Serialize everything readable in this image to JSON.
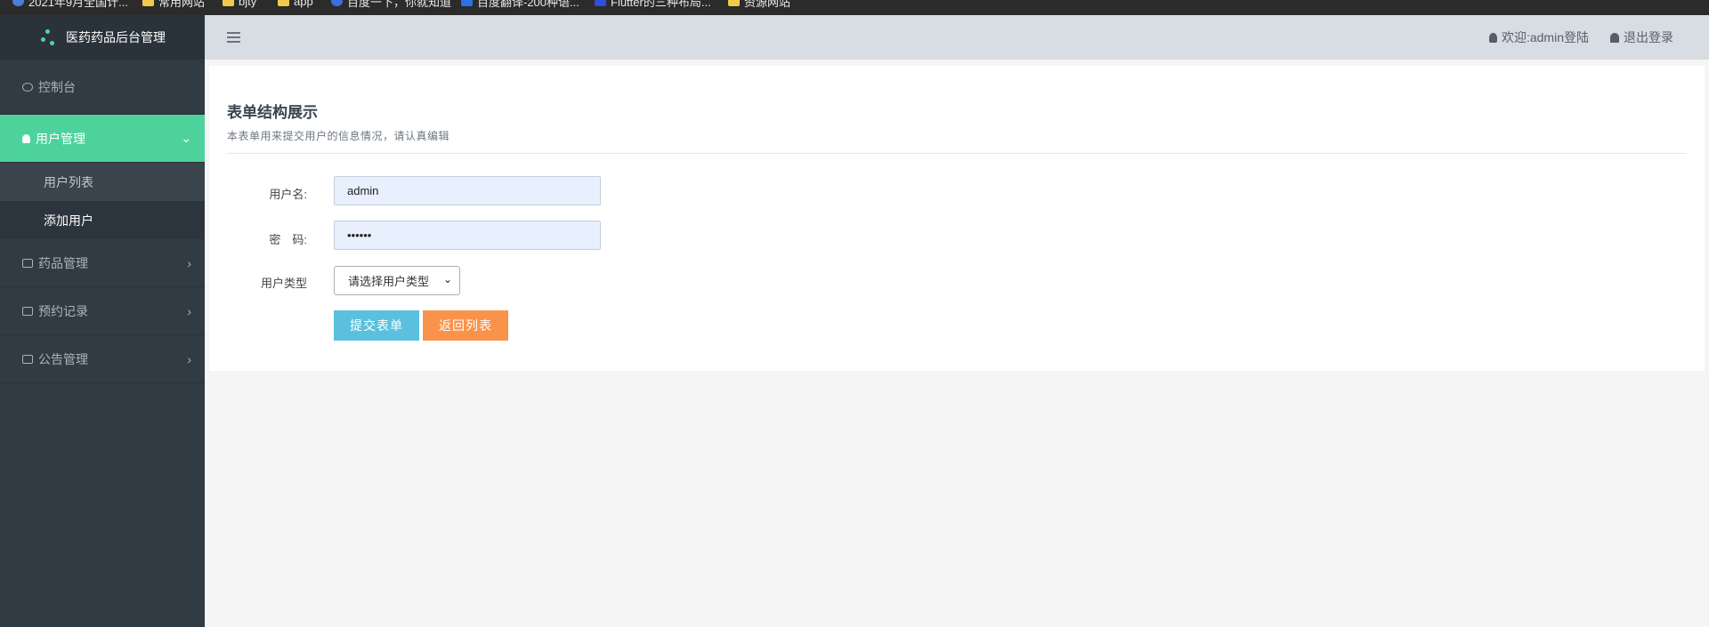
{
  "bookmarks": [
    {
      "label": "2021年9月全国计...",
      "icon": "globe-icon"
    },
    {
      "label": "常用网站",
      "icon": "folder-icon"
    },
    {
      "label": "bjty",
      "icon": "folder-icon"
    },
    {
      "label": "app",
      "icon": "folder-icon"
    },
    {
      "label": "百度一下，你就知道",
      "icon": "baidu-icon"
    },
    {
      "label": "百度翻译-200种语...",
      "icon": "translate-icon"
    },
    {
      "label": "Flutter的三种布局...",
      "icon": "xd-icon"
    },
    {
      "label": "资源网站",
      "icon": "folder-icon"
    }
  ],
  "brand": {
    "title": "医药药品后台管理",
    "logo_color": "#4fd3a8"
  },
  "sidebar": {
    "items": [
      {
        "label": "控制台",
        "icon": "dashboard-icon"
      },
      {
        "label": "用户管理",
        "icon": "user-icon",
        "active": true,
        "children": [
          {
            "label": "用户列表"
          },
          {
            "label": "添加用户",
            "current": true
          }
        ]
      },
      {
        "label": "药品管理",
        "icon": "list-icon"
      },
      {
        "label": "预约记录",
        "icon": "list-icon"
      },
      {
        "label": "公告管理",
        "icon": "list-icon"
      }
    ],
    "active_color": "#4ed29b"
  },
  "topbar": {
    "welcome": "欢迎:admin登陆",
    "logout": "退出登录"
  },
  "form": {
    "title": "表单结构展示",
    "description": "本表单用来提交用户的信息情况，请认真编辑",
    "username_label": "用户名:",
    "username_value": "admin",
    "password_label": "密　码:",
    "password_value": "••••••",
    "type_label": "用户类型",
    "type_selected": "请选择用户类型",
    "submit_label": "提交表单",
    "back_label": "返回列表"
  },
  "colors": {
    "submit_button": "#5bc0de",
    "back_button": "#f9924a",
    "sidebar_bg": "#313b44",
    "topbar_bg": "#d8dde3"
  }
}
